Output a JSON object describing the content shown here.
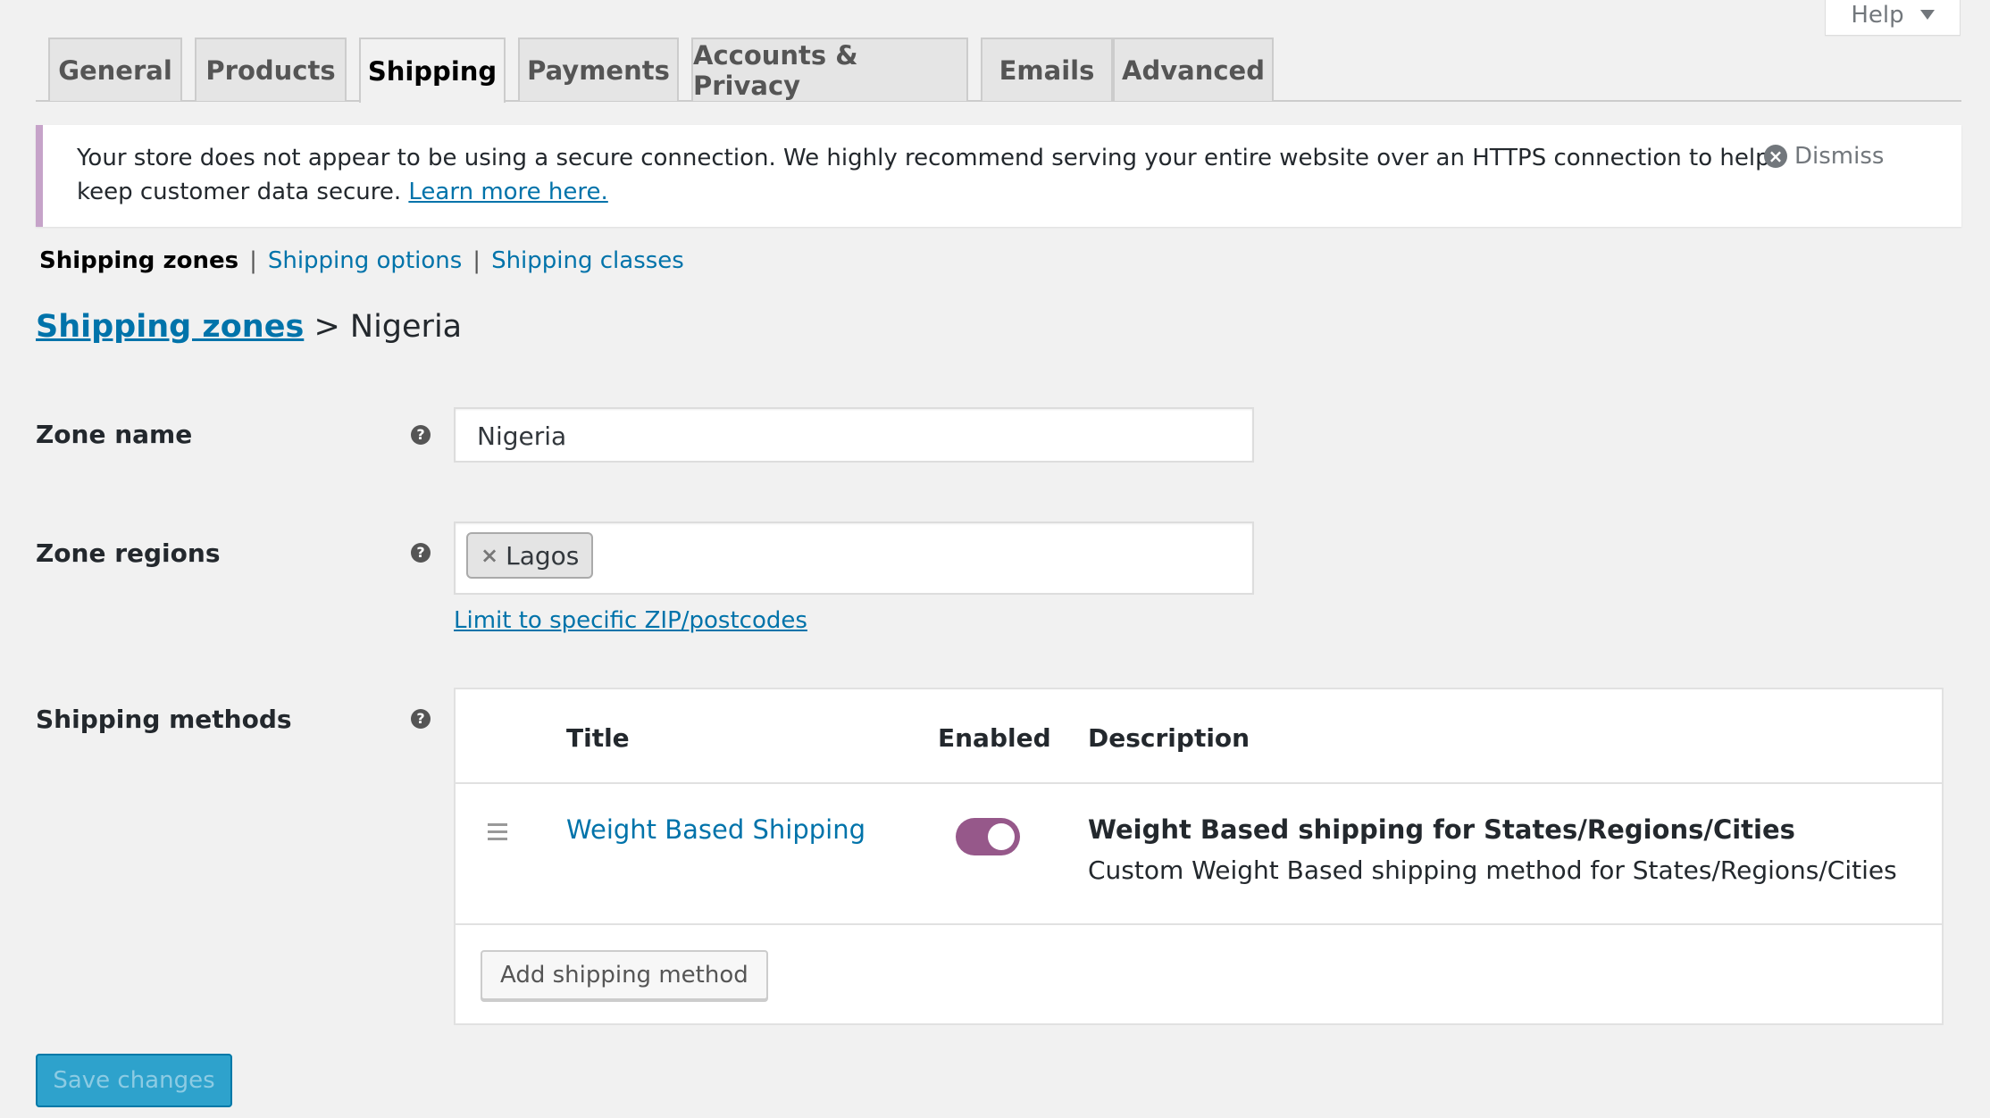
{
  "help": {
    "label": "Help"
  },
  "tabs": [
    {
      "label": "General"
    },
    {
      "label": "Products"
    },
    {
      "label": "Shipping",
      "active": true
    },
    {
      "label": "Payments"
    },
    {
      "label": "Accounts & Privacy"
    },
    {
      "label": "Emails"
    },
    {
      "label": "Advanced"
    }
  ],
  "notice": {
    "text": "Your store does not appear to be using a secure connection. We highly recommend serving your entire website over an HTTPS connection to help keep customer data secure.",
    "link": "Learn more here.",
    "dismiss": "Dismiss"
  },
  "subnav": {
    "current": "Shipping zones",
    "options": "Shipping options",
    "classes": "Shipping classes",
    "separator": "|"
  },
  "breadcrumb": {
    "link": "Shipping zones",
    "separator": ">",
    "current": "Nigeria"
  },
  "form": {
    "zone_name_label": "Zone name",
    "zone_name_value": "Nigeria",
    "zone_regions_label": "Zone regions",
    "region_chip": "Lagos",
    "limit_link": "Limit to specific ZIP/postcodes",
    "shipping_methods_label": "Shipping methods",
    "help_icon": "?"
  },
  "methods": {
    "headers": {
      "title": "Title",
      "enabled": "Enabled",
      "description": "Description"
    },
    "rows": [
      {
        "title": "Weight Based Shipping",
        "enabled": true,
        "desc_title": "Weight Based shipping for States/Regions/Cities",
        "desc_text": "Custom Weight Based shipping method for States/Regions/Cities"
      }
    ],
    "add_button": "Add shipping method"
  },
  "save_button": "Save changes",
  "colors": {
    "accent": "#0073aa",
    "toggle": "#96588a",
    "notice_border": "#c6a3c9",
    "save": "#2ea2cc"
  }
}
